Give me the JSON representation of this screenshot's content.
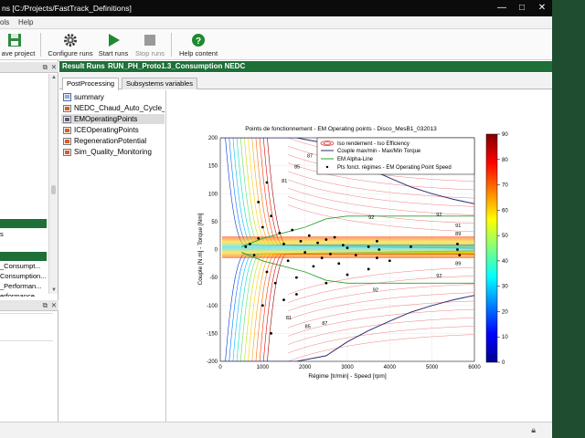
{
  "window": {
    "title": "ns [C:/Projects/FastTrack_Definitions]",
    "minimize_label": "—",
    "maximize_label": "□",
    "close_label": "✕"
  },
  "menu": {
    "items": [
      "ols",
      "Help"
    ]
  },
  "toolbar": {
    "save_label": "ave project",
    "configure_label": "Configure runs",
    "start_label": "Start runs",
    "stop_label": "Stop runs",
    "help_label": "Help content"
  },
  "left_panel": {
    "items": [
      "s",
      "_Consumpt...",
      "Consumption...",
      "_Performan...",
      "erformance..."
    ]
  },
  "result_runs": {
    "label": "Result Runs",
    "run_name": "RUN_PH_Proto1.3_Consumption NEDC"
  },
  "tabs": [
    {
      "label": "PostProcessing"
    },
    {
      "label": "Subsystems variables"
    }
  ],
  "tree": {
    "items": [
      {
        "label": "summary",
        "icon": "summary-icon"
      },
      {
        "label": "NEDC_Chaud_Auto_Cycle_r",
        "icon": "folder-icon"
      },
      {
        "label": "EMOperatingPoints",
        "icon": "folder-icon"
      },
      {
        "label": "ICEOperatingPoints",
        "icon": "folder-icon"
      },
      {
        "label": "RegenerationPotential",
        "icon": "folder-icon"
      },
      {
        "label": "Sim_Quality_Monitoring",
        "icon": "folder-icon"
      }
    ]
  },
  "chart_data": {
    "type": "scatter",
    "title": "Points de fonctionnement - EM Operating points - Disco_MesB1_032013",
    "xlabel": "Régime [tr/min] - Speed [rpm]",
    "ylabel": "Couple [N.m] - Torque [Nm]",
    "xlim": [
      0,
      6000
    ],
    "ylim": [
      -200,
      200
    ],
    "xticks": [
      0,
      1000,
      2000,
      3000,
      4000,
      5000,
      6000
    ],
    "yticks": [
      -200,
      -150,
      -100,
      -50,
      0,
      50,
      100,
      150,
      200
    ],
    "grid": true,
    "legend_position": "top-center",
    "legend": [
      "Iso rendement - Iso Efficiency",
      "Couple max/min - Max/Min Torque",
      "EM Alpha-Line",
      "Pts fonct. régimes - EM Operating Point Speed"
    ],
    "colorbar": {
      "min": 0,
      "max": 90,
      "ticks": [
        0,
        10,
        20,
        30,
        40,
        50,
        60,
        70,
        80,
        90
      ]
    },
    "max_torque_curve": {
      "x": [
        0,
        1000,
        1800,
        2500,
        3000,
        3500,
        4000,
        4500,
        5000,
        5500,
        6000
      ],
      "y": [
        200,
        200,
        200,
        190,
        165,
        145,
        128,
        112,
        100,
        90,
        82
      ]
    },
    "min_torque_curve": {
      "x": [
        0,
        1000,
        1800,
        2500,
        3000,
        3500,
        4000,
        4500,
        5000,
        5500,
        6000
      ],
      "y": [
        -200,
        -200,
        -200,
        -190,
        -165,
        -145,
        -128,
        -112,
        -100,
        -90,
        -82
      ]
    },
    "alpha_line": {
      "x": [
        500,
        1000,
        2000,
        2500,
        3000,
        3500,
        4000,
        4500,
        5000,
        5500,
        6000
      ],
      "y": [
        5,
        20,
        40,
        55,
        60,
        60,
        60,
        60,
        60,
        60,
        60
      ]
    },
    "iso_labels": [
      {
        "x": 1450,
        "y": 120,
        "label": "81"
      },
      {
        "x": 1750,
        "y": 145,
        "label": "85"
      },
      {
        "x": 2050,
        "y": 165,
        "label": "87"
      },
      {
        "x": 3500,
        "y": 55,
        "label": "92"
      },
      {
        "x": 5100,
        "y": 60,
        "label": "92"
      },
      {
        "x": 5550,
        "y": 40,
        "label": "91"
      },
      {
        "x": 5550,
        "y": 25,
        "label": "89"
      },
      {
        "x": 1550,
        "y": -125,
        "label": "81"
      },
      {
        "x": 2000,
        "y": -140,
        "label": "85"
      },
      {
        "x": 2400,
        "y": -135,
        "label": "87"
      },
      {
        "x": 3600,
        "y": -75,
        "label": "92"
      },
      {
        "x": 5100,
        "y": -50,
        "label": "92"
      },
      {
        "x": 5550,
        "y": -28,
        "label": "89"
      }
    ],
    "operating_points": [
      {
        "x": 600,
        "y": 5
      },
      {
        "x": 700,
        "y": 10
      },
      {
        "x": 800,
        "y": -10
      },
      {
        "x": 900,
        "y": 20
      },
      {
        "x": 1000,
        "y": 40
      },
      {
        "x": 1100,
        "y": -40
      },
      {
        "x": 1200,
        "y": 60
      },
      {
        "x": 1300,
        "y": -60
      },
      {
        "x": 1400,
        "y": 30
      },
      {
        "x": 1500,
        "y": 10
      },
      {
        "x": 1600,
        "y": -20
      },
      {
        "x": 1700,
        "y": 35
      },
      {
        "x": 1800,
        "y": -50
      },
      {
        "x": 1900,
        "y": 15
      },
      {
        "x": 2000,
        "y": -5
      },
      {
        "x": 2100,
        "y": 25
      },
      {
        "x": 2200,
        "y": -30
      },
      {
        "x": 2300,
        "y": 12
      },
      {
        "x": 2400,
        "y": -15
      },
      {
        "x": 2500,
        "y": 18
      },
      {
        "x": 2600,
        "y": -8
      },
      {
        "x": 2700,
        "y": 22
      },
      {
        "x": 2800,
        "y": -25
      },
      {
        "x": 2900,
        "y": 8
      },
      {
        "x": 3000,
        "y": 3
      },
      {
        "x": 3200,
        "y": -10
      },
      {
        "x": 3500,
        "y": 5
      },
      {
        "x": 3700,
        "y": 15
      },
      {
        "x": 3700,
        "y": -15
      },
      {
        "x": 3750,
        "y": 0
      },
      {
        "x": 4000,
        "y": -20
      },
      {
        "x": 4500,
        "y": 5
      },
      {
        "x": 5600,
        "y": 10
      },
      {
        "x": 5650,
        "y": -10
      },
      {
        "x": 5600,
        "y": 0
      },
      {
        "x": 1000,
        "y": -100
      },
      {
        "x": 1200,
        "y": -150
      },
      {
        "x": 1500,
        "y": -90
      },
      {
        "x": 1800,
        "y": -80
      },
      {
        "x": 2500,
        "y": -60
      },
      {
        "x": 3000,
        "y": -45
      },
      {
        "x": 3500,
        "y": -35
      },
      {
        "x": 1100,
        "y": 120
      },
      {
        "x": 900,
        "y": 85
      }
    ]
  }
}
